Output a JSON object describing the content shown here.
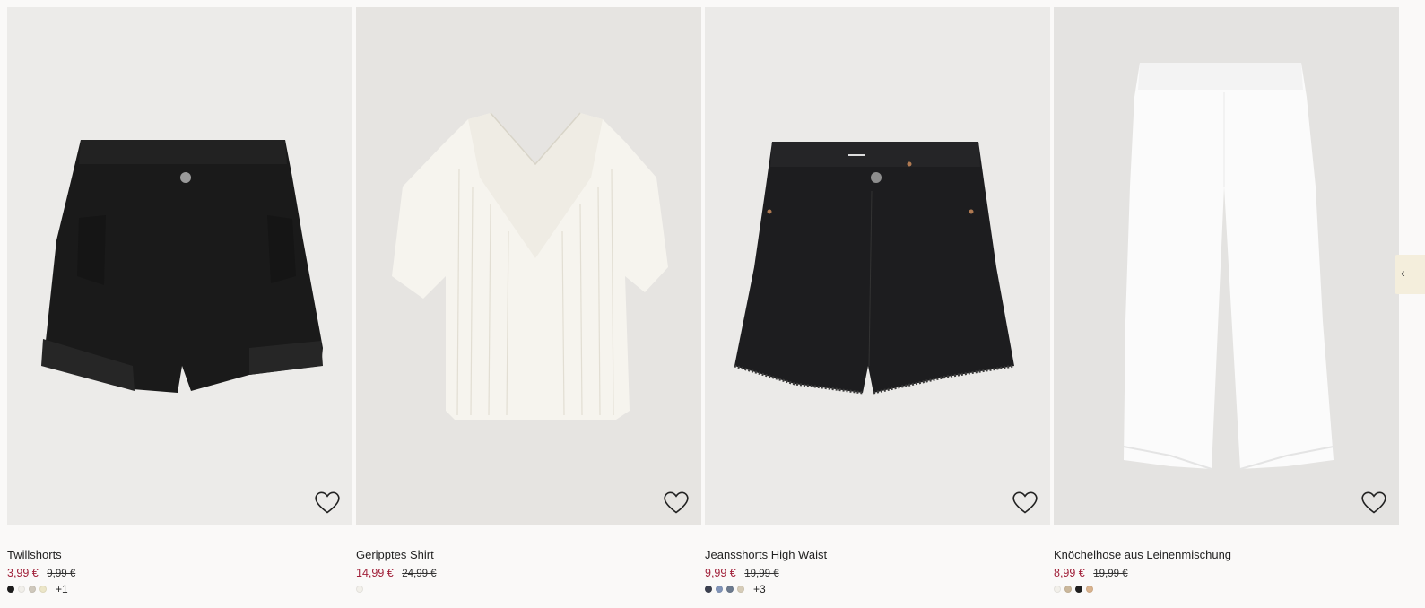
{
  "products": [
    {
      "title": "Twillshorts",
      "sale_price": "3,99 €",
      "old_price": "9,99 €",
      "swatches": [
        "#1c1c1c",
        "#f1efea",
        "#cfc8bc",
        "#ece6c8"
      ],
      "more_colors": "+1",
      "favorite_icon": "heart-outline-icon"
    },
    {
      "title": "Geripptes Shirt",
      "sale_price": "14,99 €",
      "old_price": "24,99 €",
      "swatches": [
        "#f2f0ea"
      ],
      "more_colors": "",
      "favorite_icon": "heart-outline-icon"
    },
    {
      "title": "Jeansshorts High Waist",
      "sale_price": "9,99 €",
      "old_price": "19,99 €",
      "swatches": [
        "#3c4150",
        "#8194b8",
        "#6c7a8e",
        "#d6ccb8"
      ],
      "more_colors": "+3",
      "favorite_icon": "heart-outline-icon"
    },
    {
      "title": "Knöchelhose aus Leinenmischung",
      "sale_price": "8,99 €",
      "old_price": "19,99 €",
      "swatches": [
        "#f2f0ea",
        "#cbb89c",
        "#1f1f1f",
        "#d9b38e"
      ],
      "more_colors": "",
      "favorite_icon": "heart-outline-icon"
    }
  ],
  "carousel": {
    "next_icon": "chevron-right-icon"
  },
  "colors": {
    "sale": "#a1213a",
    "background": "#faf9f8"
  }
}
